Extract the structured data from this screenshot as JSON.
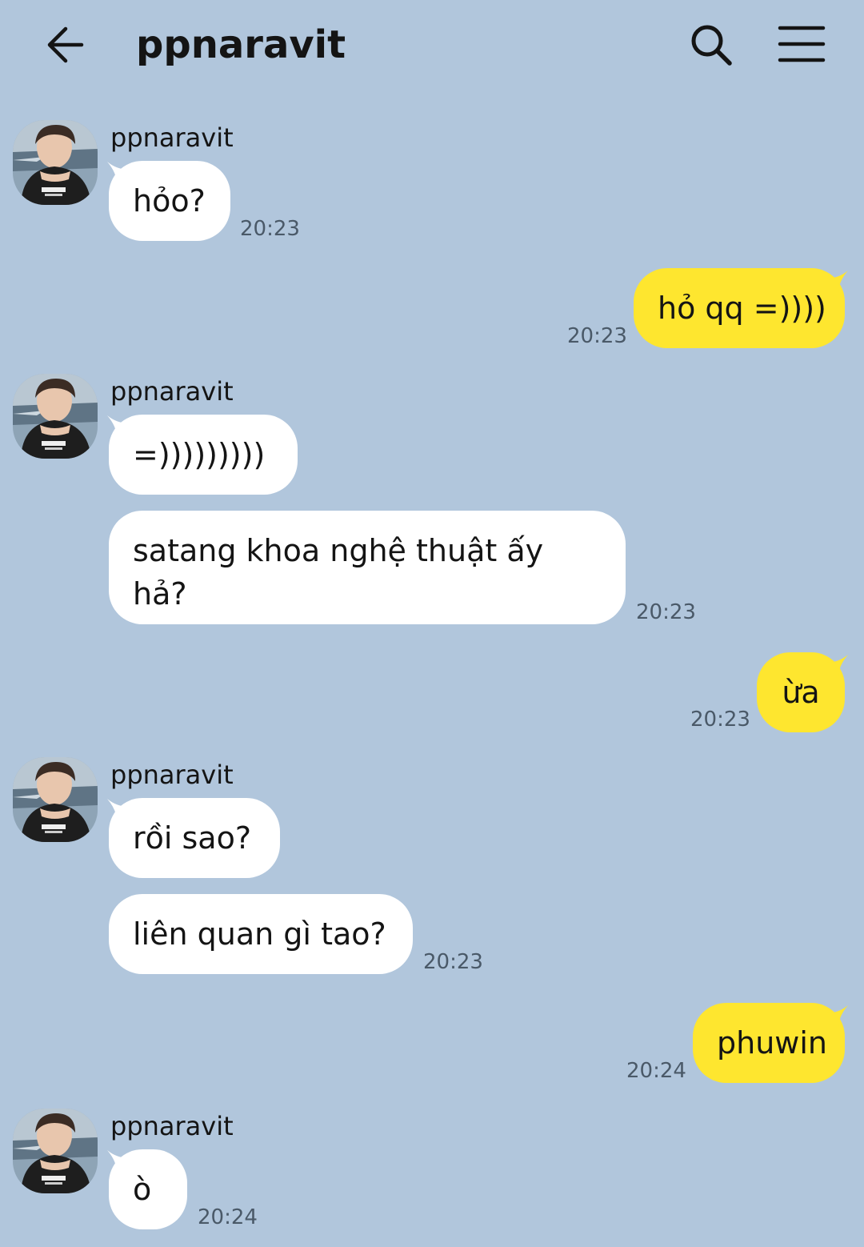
{
  "header": {
    "title": "ppnaravit"
  },
  "colors": {
    "background": "#b1c6dc",
    "incoming_bubble": "#ffffff",
    "outgoing_bubble": "#fee62f",
    "text": "#141414",
    "timestamp": "#4a5968"
  },
  "icons": {
    "back": "arrow-left-icon",
    "search": "search-icon",
    "menu": "hamburger-menu-icon"
  },
  "messages": [
    {
      "sender": "ppnaravit",
      "direction": "incoming",
      "text": "hỏo?",
      "time": "20:23"
    },
    {
      "direction": "outgoing",
      "text": "hỏ qq =))))",
      "time": "20:23"
    },
    {
      "sender": "ppnaravit",
      "direction": "incoming",
      "text": "=)))))))))"
    },
    {
      "direction": "incoming",
      "text": "satang khoa nghệ thuật ấy hả?",
      "time": "20:23"
    },
    {
      "direction": "outgoing",
      "text": "ừa",
      "time": "20:23"
    },
    {
      "sender": "ppnaravit",
      "direction": "incoming",
      "text": "rồi sao?"
    },
    {
      "direction": "incoming",
      "text": "liên quan gì tao?",
      "time": "20:23"
    },
    {
      "direction": "outgoing",
      "text": "phuwin",
      "time": "20:24"
    },
    {
      "sender": "ppnaravit",
      "direction": "incoming",
      "text": "ò",
      "time": "20:24"
    }
  ]
}
